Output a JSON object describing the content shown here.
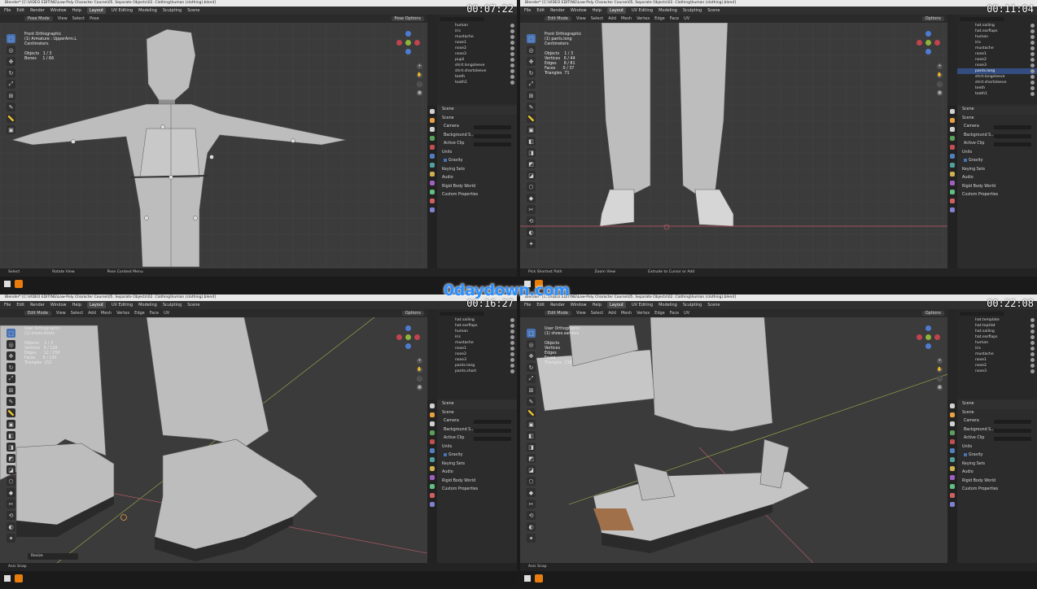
{
  "watermark": "0daydown.com",
  "colors": {
    "accent": "#4772b3",
    "orange": "#e87d0d",
    "axis_x": "#c45b6a",
    "axis_y": "#9fb34a"
  },
  "panels": [
    {
      "timestamp": "00:07:22",
      "title": "Blender* [C:\\VIDEO EDITING\\Low-Poly Character Course\\05. Separate Objects\\02. Clothing\\human (clothing).blend]",
      "menu": [
        "File",
        "Edit",
        "Render",
        "Window",
        "Help",
        "Layout",
        "UV Editing",
        "Modeling",
        "Sculpting",
        "Scene"
      ],
      "mode": "Pose Mode",
      "header_items": [
        "View",
        "Select",
        "Pose"
      ],
      "options": "Pose Options",
      "overlay": "Front Orthographic\n(1) Armature : UpperArm.L\nCentimeters\n\nObjects   1 / 3\nBones     1 / 66",
      "outliner": [
        "human",
        "iris",
        "mustache",
        "nose1",
        "nose2",
        "nose3",
        "pupil",
        "shirt.longsleeve",
        "shirt.shortsleeve",
        "teeth",
        "tooth1"
      ],
      "outliner_selected": -1,
      "props_title": "Scene",
      "props": [
        "Scene",
        "Camera",
        "Background S...",
        "Active Clip",
        "Units",
        "Gravity",
        "Keying Sets",
        "Audio",
        "Rigid Body World",
        "Custom Properties"
      ],
      "status": [
        "Select",
        "Rotate View",
        "Pose Context Menu"
      ]
    },
    {
      "timestamp": "00:11:04",
      "title": "Blender* [C:\\VIDEO EDITING\\Low-Poly Character Course\\05. Separate Objects\\02. Clothing\\human (clothing).blend]",
      "menu": [
        "File",
        "Edit",
        "Render",
        "Window",
        "Help",
        "Layout",
        "UV Editing",
        "Modeling",
        "Sculpting",
        "Scene"
      ],
      "mode": "Edit Mode",
      "header_items": [
        "View",
        "Select",
        "Add",
        "Mesh",
        "Vertex",
        "Edge",
        "Face",
        "UV"
      ],
      "options": "Options",
      "overlay": "Front Orthographic\n(1) pants.long\nCentimeters\n\nObjects    1 / 3\nVertices   6 / 44\nEdges      8 / 81\nFaces      0 / 37\nTriangles  71",
      "outliner": [
        "hat.sailing",
        "hat.earflaps",
        "human",
        "iris",
        "mustache",
        "nose1",
        "nose2",
        "nose3",
        "pants.long",
        "shirt.longsleeve",
        "shirt.shortsleeve",
        "teeth",
        "tooth1"
      ],
      "outliner_selected": 8,
      "props_title": "Scene",
      "props": [
        "Scene",
        "Camera",
        "Background S...",
        "Active Clip",
        "Units",
        "Gravity",
        "Keying Sets",
        "Audio",
        "Rigid Body World",
        "Custom Properties"
      ],
      "status": [
        "Pick Shortest Path",
        "Zoom View",
        "Extrude to Cursor or Add"
      ]
    },
    {
      "timestamp": "00:16:27",
      "title": "Blender* [C:\\VIDEO EDITING\\Low-Poly Character Course\\05. Separate Objects\\02. Clothing\\human (clothing).blend]",
      "menu": [
        "File",
        "Edit",
        "Render",
        "Window",
        "Help",
        "Layout",
        "UV Editing",
        "Modeling",
        "Sculpting",
        "Scene"
      ],
      "mode": "Edit Mode",
      "header_items": [
        "View",
        "Select",
        "Add",
        "Mesh",
        "Vertex",
        "Edge",
        "Face",
        "UV"
      ],
      "options": "Options",
      "overlay": "User Orthographic\n(1) shoes.boots\n\nObjects    1 / 3\nVertices   6 / 128\nEdges      12 / 256\nFaces      6 / 130\nTriangles  252",
      "outliner": [
        "hat.sailing",
        "hat.earflaps",
        "human",
        "iris",
        "mustache",
        "nose1",
        "nose2",
        "nose3",
        "pants.long",
        "pants.short"
      ],
      "outliner_selected": -1,
      "props_title": "Scene",
      "props": [
        "Scene",
        "Camera",
        "Background S...",
        "Active Clip",
        "Units",
        "Gravity",
        "Keying Sets",
        "Audio",
        "Rigid Body World",
        "Custom Properties"
      ],
      "status": [
        "Axis Snap"
      ],
      "popup": "Resize"
    },
    {
      "timestamp": "00:22:08",
      "title": "Blender* [C:\\VIDEO EDITING\\Low-Poly Character Course\\05. Separate Objects\\02. Clothing\\human (clothing).blend]",
      "menu": [
        "File",
        "Edit",
        "Render",
        "Window",
        "Help",
        "Layout",
        "UV Editing",
        "Modeling",
        "Sculpting",
        "Scene"
      ],
      "mode": "Edit Mode",
      "header_items": [
        "View",
        "Select",
        "Add",
        "Mesh",
        "Vertex",
        "Edge",
        "Face",
        "UV"
      ],
      "options": "Options",
      "overlay": "User Orthographic\n(1) shoes.sandals\n\nObjects\nVertices\nEdges\nFaces\nTriangles  138",
      "outliner": [
        "hat.template",
        "hat.topHat",
        "hat.sailing",
        "hat.earflaps",
        "human",
        "iris",
        "mustache",
        "nose1",
        "nose2",
        "nose3"
      ],
      "outliner_selected": -1,
      "props_title": "Scene",
      "props": [
        "Scene",
        "Camera",
        "Background S...",
        "Active Clip",
        "Units",
        "Gravity",
        "Keying Sets",
        "Audio",
        "Rigid Body World",
        "Custom Properties"
      ],
      "status": [
        "Axis Snap"
      ]
    }
  ]
}
